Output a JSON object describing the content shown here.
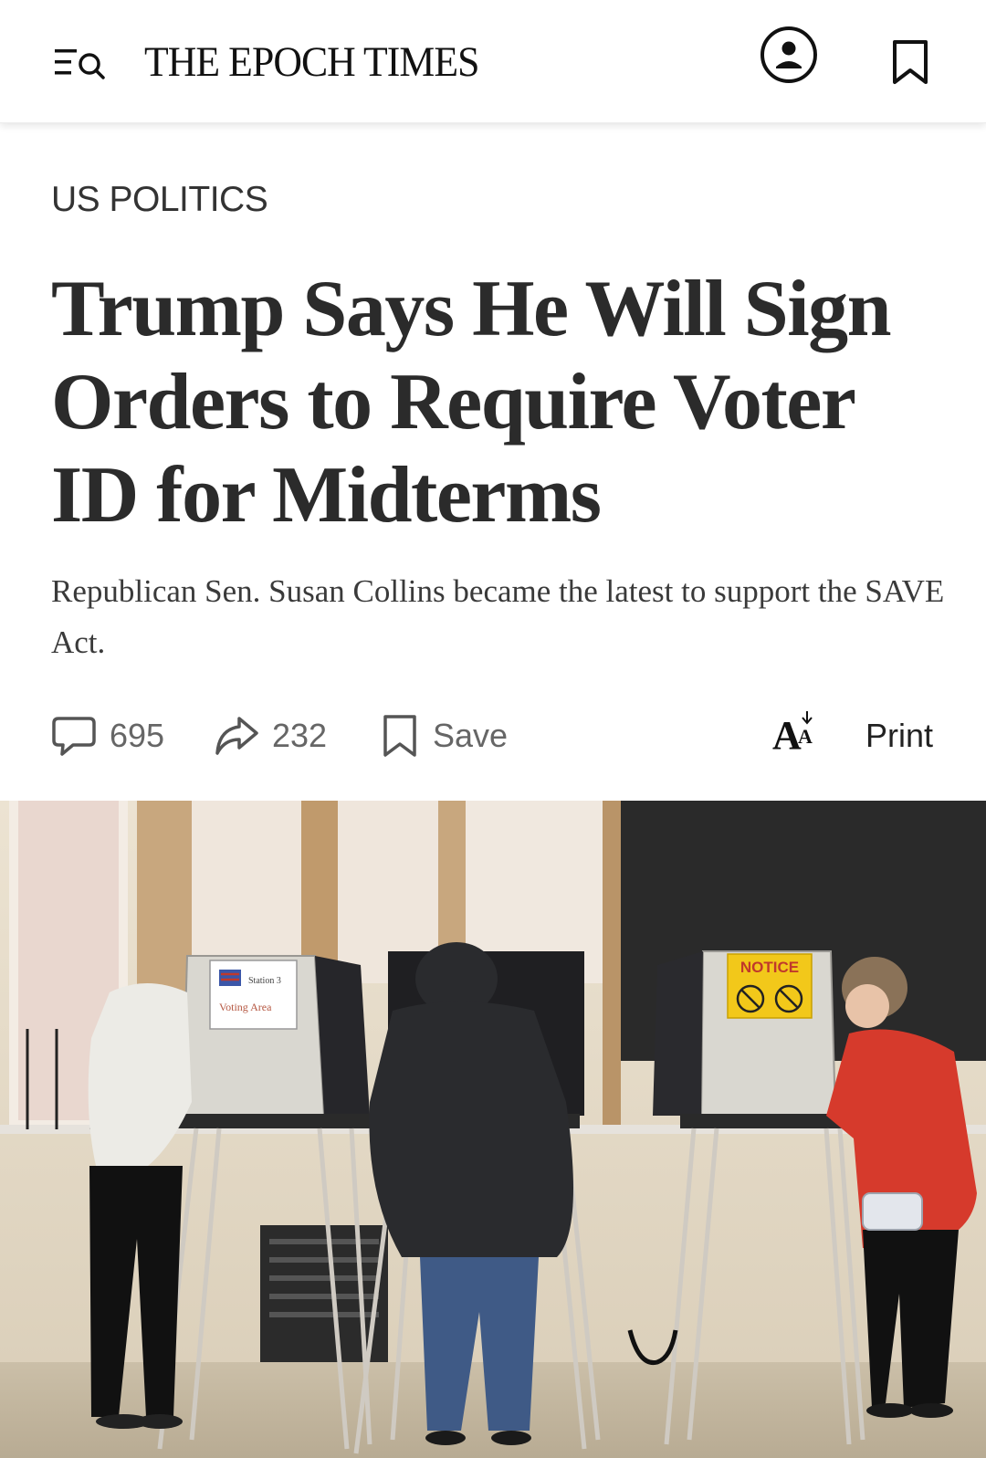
{
  "header": {
    "masthead": "THE EPOCH TIMES",
    "menu_icon": "menu-search-icon",
    "account_icon": "user-circle-icon",
    "bookmark_icon": "bookmark-icon"
  },
  "article": {
    "section": "US POLITICS",
    "headline": "Trump Says He Will Sign Orders to Require Voter ID for Midterms",
    "subheadline": "Republican Sen. Susan Collins became the latest to support the SAVE Act."
  },
  "actions": {
    "comments_count": "695",
    "shares_count": "232",
    "save_label": "Save",
    "text_size_label": "A",
    "print_label": "Print"
  },
  "photo": {
    "booth_sign_left_line1": "Station 3",
    "booth_sign_left_line2": "Voting Area",
    "booth_sign_right": "NOTICE"
  },
  "colors": {
    "notice_yellow": "#f2c81a",
    "coat_red": "#d63a2c",
    "coat_black": "#2a2b2e",
    "jeans_blue": "#3f5a86"
  }
}
